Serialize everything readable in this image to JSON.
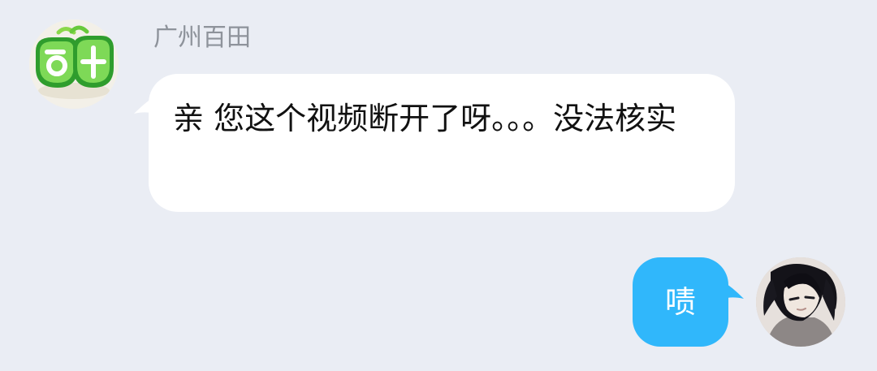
{
  "conversation": {
    "incoming": {
      "sender_name": "广州百田",
      "avatar_icon": "brand-logo-icon",
      "message": "亲 您这个视频断开了呀。。。没法核实",
      "bubble_color": "#ffffff"
    },
    "outgoing": {
      "avatar_icon": "user-avatar-icon",
      "message": "啧",
      "bubble_color": "#30b7fb"
    }
  },
  "colors": {
    "background": "#eaedf4",
    "sender_name": "#8e939b",
    "incoming_text": "#111111",
    "outgoing_text": "#ffffff"
  }
}
